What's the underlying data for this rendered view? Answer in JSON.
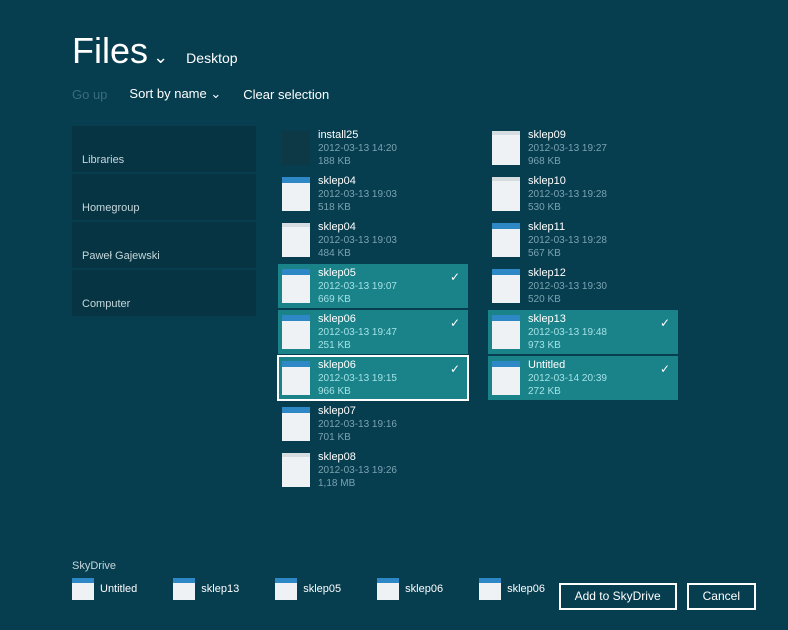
{
  "header": {
    "title": "Files",
    "location": "Desktop"
  },
  "toolbar": {
    "go_up": "Go up",
    "sort": "Sort by name",
    "clear": "Clear selection"
  },
  "sidebar": {
    "items": [
      {
        "label": "Libraries"
      },
      {
        "label": "Homegroup"
      },
      {
        "label": "Paweł Gajewski"
      },
      {
        "label": "Computer"
      }
    ]
  },
  "files_col1": [
    {
      "name": "install25",
      "date": "2012-03-13 14:20",
      "size": "188 KB",
      "selected": false,
      "thumb": "install"
    },
    {
      "name": "sklep04",
      "date": "2012-03-13 19:03",
      "size": "518 KB",
      "selected": false,
      "thumb": "web"
    },
    {
      "name": "sklep04",
      "date": "2012-03-13 19:03",
      "size": "484 KB",
      "selected": false,
      "thumb": "doc"
    },
    {
      "name": "sklep05",
      "date": "2012-03-13 19:07",
      "size": "669 KB",
      "selected": true,
      "thumb": "web"
    },
    {
      "name": "sklep06",
      "date": "2012-03-13 19:47",
      "size": "251 KB",
      "selected": true,
      "thumb": "web"
    },
    {
      "name": "sklep06",
      "date": "2012-03-13 19:15",
      "size": "966 KB",
      "selected": true,
      "thumb": "web",
      "focused": true
    },
    {
      "name": "sklep07",
      "date": "2012-03-13 19:16",
      "size": "701 KB",
      "selected": false,
      "thumb": "web"
    },
    {
      "name": "sklep08",
      "date": "2012-03-13 19:26",
      "size": "1,18 MB",
      "selected": false,
      "thumb": "doc"
    }
  ],
  "files_col2": [
    {
      "name": "sklep09",
      "date": "2012-03-13 19:27",
      "size": "968 KB",
      "selected": false,
      "thumb": "doc"
    },
    {
      "name": "sklep10",
      "date": "2012-03-13 19:28",
      "size": "530 KB",
      "selected": false,
      "thumb": "doc"
    },
    {
      "name": "sklep11",
      "date": "2012-03-13 19:28",
      "size": "567 KB",
      "selected": false,
      "thumb": "web"
    },
    {
      "name": "sklep12",
      "date": "2012-03-13 19:30",
      "size": "520 KB",
      "selected": false,
      "thumb": "web"
    },
    {
      "name": "sklep13",
      "date": "2012-03-13 19:48",
      "size": "973 KB",
      "selected": true,
      "thumb": "web"
    },
    {
      "name": "Untitled",
      "date": "2012-03-14 20:39",
      "size": "272 KB",
      "selected": true,
      "thumb": "web"
    }
  ],
  "footer": {
    "label": "SkyDrive",
    "selected": [
      {
        "name": "Untitled"
      },
      {
        "name": "sklep13"
      },
      {
        "name": "sklep05"
      },
      {
        "name": "sklep06"
      },
      {
        "name": "sklep06"
      }
    ],
    "primary": "Add to SkyDrive",
    "cancel": "Cancel"
  }
}
